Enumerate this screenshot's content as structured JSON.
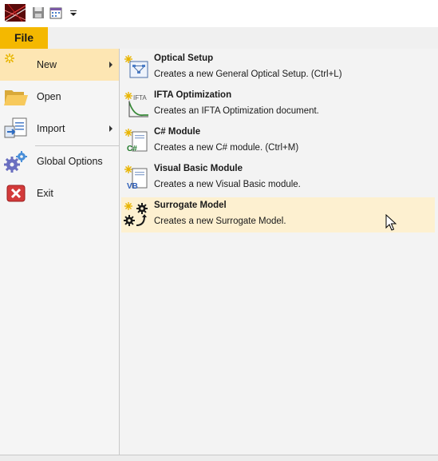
{
  "ribbon": {
    "file_tab": "File"
  },
  "left_menu": {
    "items": [
      {
        "label": "New",
        "icon": "new-sparkle-icon",
        "submenu": true,
        "selected": true
      },
      {
        "label": "Open",
        "icon": "folder-open-icon",
        "submenu": false
      },
      {
        "label": "Import",
        "icon": "import-icon",
        "submenu": true
      },
      {
        "label": "Global Options",
        "icon": "gears-icon",
        "submenu": false
      },
      {
        "label": "Exit",
        "icon": "exit-icon",
        "submenu": false
      }
    ]
  },
  "new_submenu": {
    "items": [
      {
        "title": "Optical Setup",
        "desc": "Creates a new General Optical Setup. (Ctrl+L)",
        "icon": "optical-setup-icon"
      },
      {
        "title": "IFTA Optimization",
        "desc": "Creates an IFTA Optimization document.",
        "icon": "ifta-icon",
        "icon_text": "IFTA"
      },
      {
        "title": "C# Module",
        "desc": "Creates a new C# module. (Ctrl+M)",
        "icon": "csharp-module-icon",
        "icon_text": "C#"
      },
      {
        "title": "Visual Basic Module",
        "desc": "Creates a new Visual Basic module.",
        "icon": "vb-module-icon",
        "icon_text": "VB"
      },
      {
        "title": "Surrogate Model",
        "desc": "Creates a new Surrogate Model.",
        "icon": "surrogate-model-icon",
        "hover": true
      }
    ]
  },
  "colors": {
    "file_tab": "#f4b800",
    "selected": "#fde6b3",
    "hover": "#fdf0d0"
  }
}
